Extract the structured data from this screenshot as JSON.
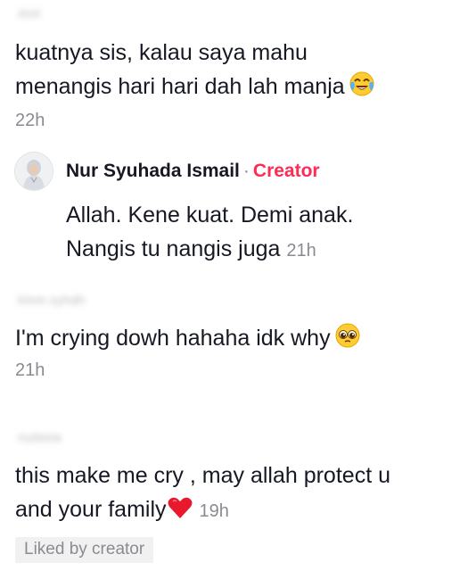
{
  "comments": [
    {
      "username": "Ainl",
      "lines": [
        "kuatnya sis, kalau saya mahu",
        "menangis hari hari dah lah manja"
      ],
      "emoji": "tears-of-joy-emoji",
      "time": "22h",
      "reply": {
        "author": "Nur Syuhada Ismail",
        "separator": "·",
        "role": "Creator",
        "lines": [
          "Allah. Kene kuat. Demi anak.",
          "Nangis tu nangis juga"
        ],
        "time": "21h"
      }
    },
    {
      "username": "limm.syhdh",
      "lines": [
        "I'm crying dowh hahaha idk why"
      ],
      "emoji": "pleading-face-emoji",
      "time": "21h"
    },
    {
      "username": "nuttiela",
      "lines": [
        "this make me cry , may allah protect u",
        "and your family"
      ],
      "emoji": "red-heart-emoji",
      "time": "19h",
      "badge": "Liked by creator"
    }
  ],
  "colors": {
    "text": "#161823",
    "muted": "#8a8b91",
    "creator": "#fe2c55",
    "badge_bg": "#f1f1f2"
  }
}
